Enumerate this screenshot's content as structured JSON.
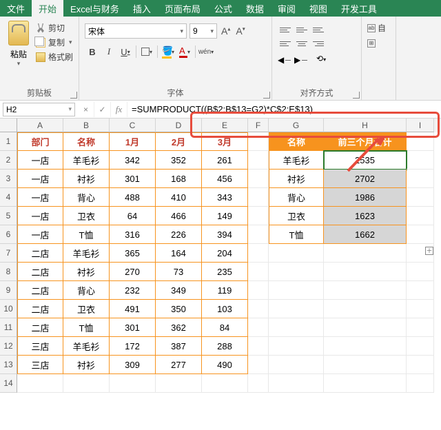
{
  "menu": {
    "file": "文件",
    "home": "开始",
    "excel_fin": "Excel与财务",
    "insert": "插入",
    "layout": "页面布局",
    "formula": "公式",
    "data": "数据",
    "review": "审阅",
    "view": "视图",
    "dev": "开发工具"
  },
  "ribbon": {
    "clipboard": {
      "label": "剪贴板",
      "paste": "粘贴",
      "cut": "剪切",
      "copy": "复制",
      "brush": "格式刷"
    },
    "font": {
      "label": "字体",
      "name": "宋体",
      "size": "9",
      "wen": "wén"
    },
    "align": {
      "label": "对齐方式"
    },
    "auto": {
      "wrap": "自"
    }
  },
  "namebox": "H2",
  "formula": "=SUMPRODUCT((B$2:B$13=G2)*C$2:E$13)",
  "cols": [
    "A",
    "B",
    "C",
    "D",
    "E",
    "F",
    "G",
    "H",
    "I"
  ],
  "table1": {
    "headers": [
      "部门",
      "名称",
      "1月",
      "2月",
      "3月"
    ],
    "rows": [
      [
        "一店",
        "羊毛衫",
        "342",
        "352",
        "261"
      ],
      [
        "一店",
        "衬衫",
        "301",
        "168",
        "456"
      ],
      [
        "一店",
        "背心",
        "488",
        "410",
        "343"
      ],
      [
        "一店",
        "卫衣",
        "64",
        "466",
        "149"
      ],
      [
        "一店",
        "T恤",
        "316",
        "226",
        "394"
      ],
      [
        "二店",
        "羊毛衫",
        "365",
        "164",
        "204"
      ],
      [
        "二店",
        "衬衫",
        "270",
        "73",
        "235"
      ],
      [
        "二店",
        "背心",
        "232",
        "349",
        "119"
      ],
      [
        "二店",
        "卫衣",
        "491",
        "350",
        "103"
      ],
      [
        "二店",
        "T恤",
        "301",
        "362",
        "84"
      ],
      [
        "三店",
        "羊毛衫",
        "172",
        "387",
        "288"
      ],
      [
        "三店",
        "衬衫",
        "309",
        "277",
        "490"
      ]
    ]
  },
  "table2": {
    "headers": [
      "名称",
      "前三个月合计"
    ],
    "rows": [
      [
        "羊毛衫",
        "2535"
      ],
      [
        "衬衫",
        "2702"
      ],
      [
        "背心",
        "1986"
      ],
      [
        "卫衣",
        "1623"
      ],
      [
        "T恤",
        "1662"
      ]
    ]
  }
}
